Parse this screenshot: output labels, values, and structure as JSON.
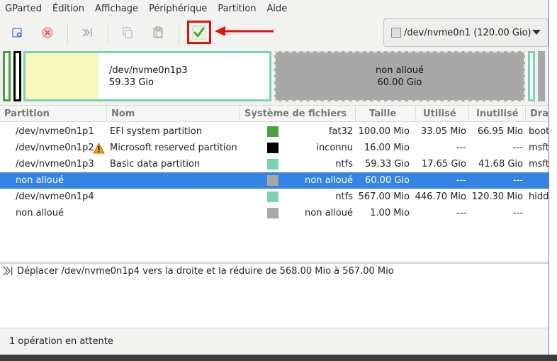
{
  "menubar": {
    "items": [
      "GParted",
      "Édition",
      "Affichage",
      "Périphérique",
      "Partition",
      "Aide"
    ]
  },
  "toolbar": {
    "buttons": [
      "new-partition-icon",
      "delete-partition-icon",
      "resize-move-icon",
      "copy-icon",
      "paste-icon",
      "apply-icon"
    ],
    "annotation_color": "#e01010"
  },
  "device_selector": {
    "value": "/dev/nvme0n1 (120.00 Gio)"
  },
  "visual": {
    "seg_p3_name": "/dev/nvme0n1p3",
    "seg_p3_size": "59.33 Gio",
    "seg_unalloc_name": "non alloué",
    "seg_unalloc_size": "60.00 Gio"
  },
  "columns": [
    "Partition",
    "Nom",
    "Système de fichiers",
    "Taille",
    "Utilisé",
    "Inutilisé",
    "Drapeaux"
  ],
  "partitions": [
    {
      "partition": "/dev/nvme0n1p1",
      "name": "EFI system partition",
      "fs": "fat32",
      "fs_color": "#4aa142",
      "size": "100.00 Mio",
      "used": "33.05 Mio",
      "unused": "66.95 Mio",
      "flags": "boot, esp"
    },
    {
      "partition": "/dev/nvme0n1p2",
      "name": "Microsoft reserved partition",
      "fs": "inconnu",
      "fs_color": "#000000",
      "size": "16.00 Mio",
      "used": "---",
      "unused": "---",
      "flags": "msftres"
    },
    {
      "partition": "/dev/nvme0n1p3",
      "name": "Basic data partition",
      "fs": "ntfs",
      "fs_color": "#79d4b4",
      "size": "59.33 Gio",
      "used": "17.65 Gio",
      "unused": "41.68 Gio",
      "flags": "msftdata"
    },
    {
      "partition": "non alloué",
      "name": "",
      "fs": "non alloué",
      "fs_color": "#a8a8a8",
      "size": "60.00 Gio",
      "used": "---",
      "unused": "---",
      "flags": ""
    },
    {
      "partition": "/dev/nvme0n1p4",
      "name": "",
      "fs": "ntfs",
      "fs_color": "#79d4b4",
      "size": "567.00 Mio",
      "used": "446.70 Mio",
      "unused": "120.30 Mio",
      "flags": "hidden, diag"
    },
    {
      "partition": "non alloué",
      "name": "",
      "fs": "non alloué",
      "fs_color": "#a8a8a8",
      "size": "1.00 Mio",
      "used": "---",
      "unused": "---",
      "flags": ""
    }
  ],
  "operations": [
    {
      "text": "Déplacer /dev/nvme0n1p4 vers la droite et la réduire de 568.00 Mio à 567.00 Mio"
    }
  ],
  "status": {
    "text": "1 opération en attente"
  }
}
